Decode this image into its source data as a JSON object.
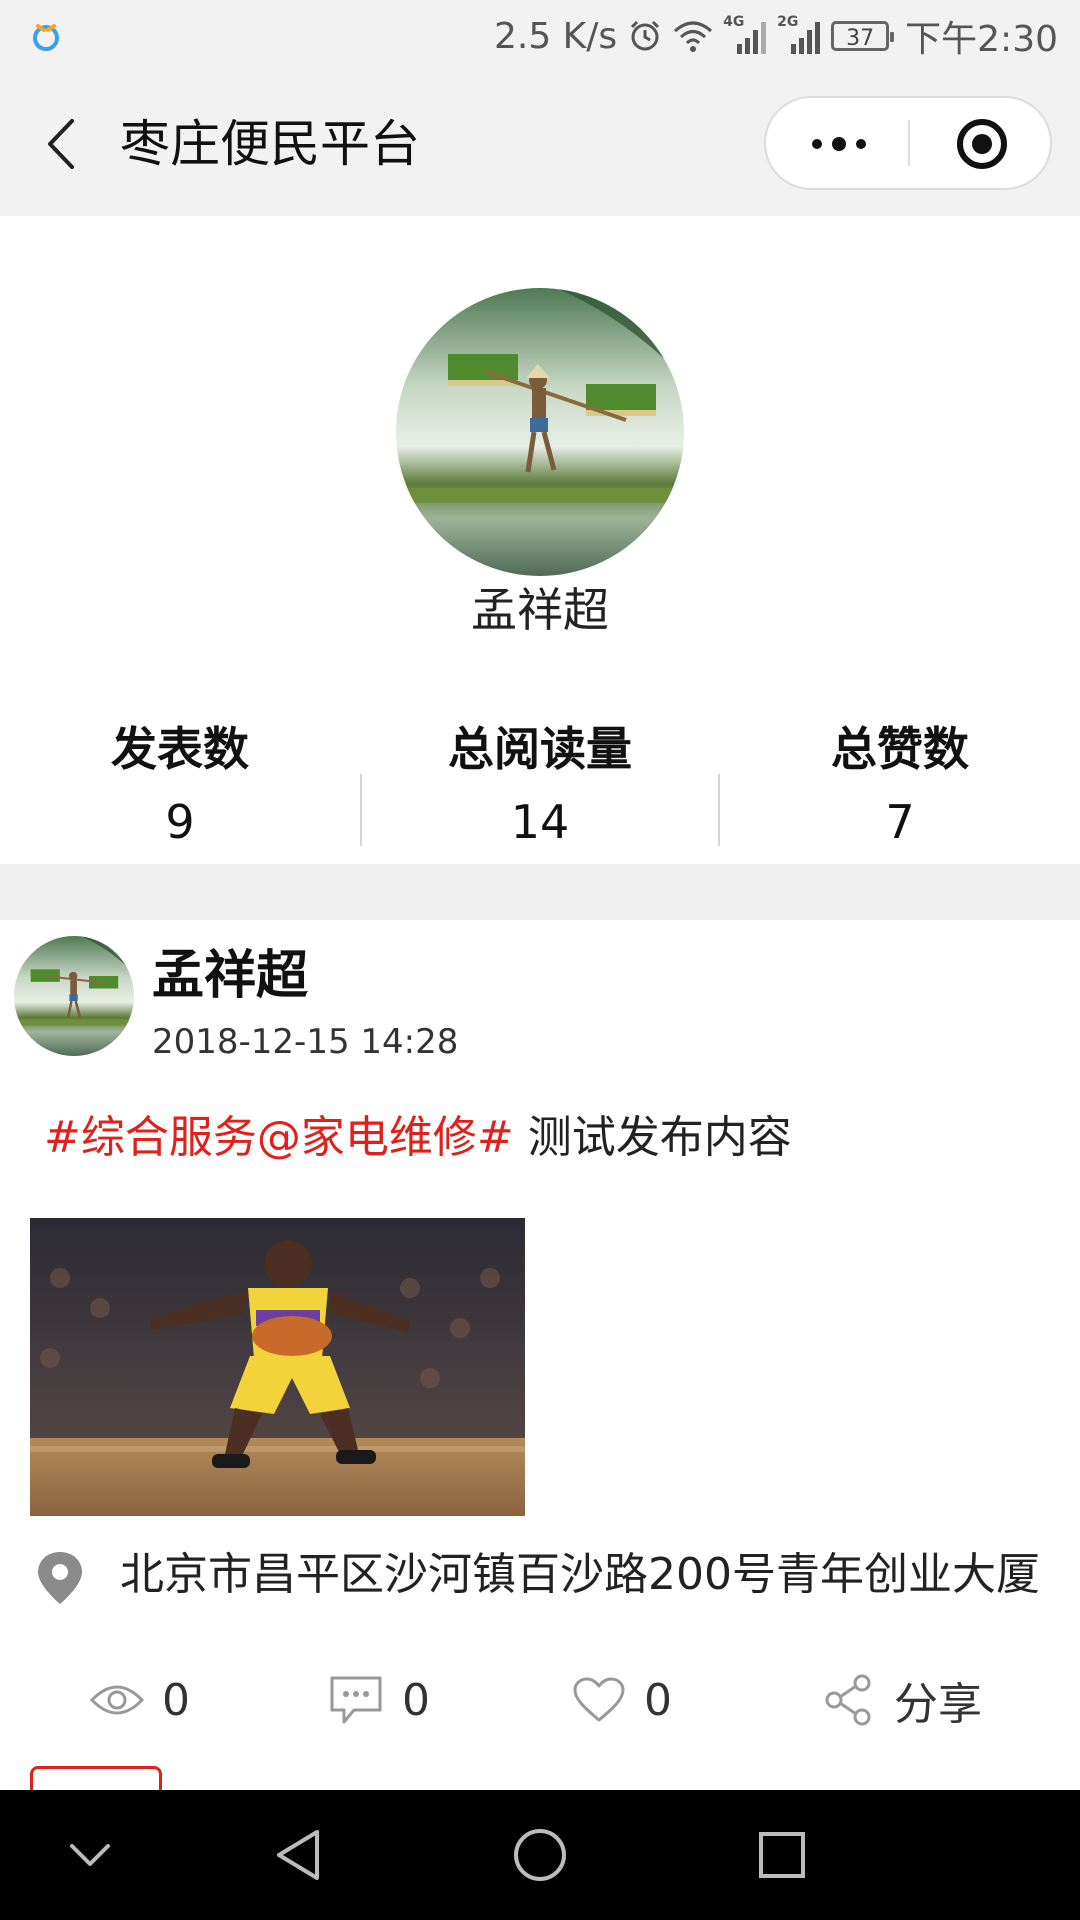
{
  "status_bar": {
    "net_speed": "2.5 K/s",
    "net_type_1": "4G",
    "net_type_2": "2G",
    "battery": "37",
    "time": "下午2:30"
  },
  "nav": {
    "title": "枣庄便民平台"
  },
  "profile": {
    "name": "孟祥超",
    "stats": [
      {
        "label": "发表数",
        "value": "9"
      },
      {
        "label": "总阅读量",
        "value": "14"
      },
      {
        "label": "总赞数",
        "value": "7"
      }
    ]
  },
  "post": {
    "author": "孟祥超",
    "time": "2018-12-15 14:28",
    "tag": "#综合服务@家电维修#",
    "text": " 测试发布内容",
    "location": "北京市昌平区沙河镇百沙路200号青年创业大厦",
    "views": "0",
    "comments": "0",
    "likes": "0",
    "share_label": "分享"
  },
  "colors": {
    "tag_red": "#e0201b",
    "nav_bg": "#f2f2f2",
    "band_bg": "#efefef"
  }
}
